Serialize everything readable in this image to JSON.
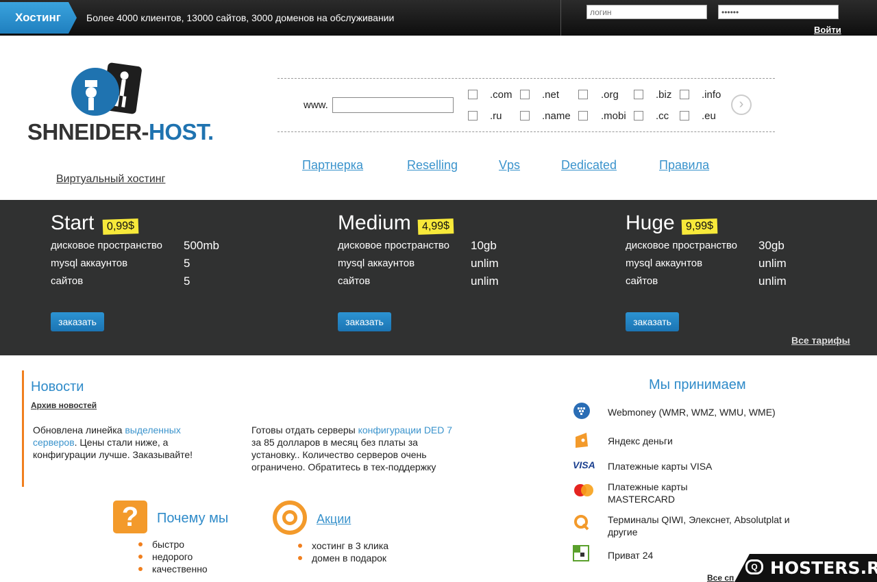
{
  "topbar": {
    "tab": "Хостинг",
    "tagline": "Более 4000 клиентов, 13000 сайтов, 3000 доменов на обслуживании",
    "login_placeholder": "логин",
    "password_value": "••••••",
    "login_button": "Войти"
  },
  "logo": {
    "text_dark": "SHNEIDER-",
    "text_blue": "HOST."
  },
  "virtual_hosting": "Виртуальный хостинг",
  "domain": {
    "prefix": "www.",
    "zones_row1": [
      ".com",
      ".net",
      ".org",
      ".biz",
      ".info"
    ],
    "zones_row2": [
      ".ru",
      ".name",
      ".mobi",
      ".cc",
      ".eu"
    ]
  },
  "nav": [
    "Партнерка",
    "Reselling",
    "Vps",
    "Dedicated",
    "Правила"
  ],
  "plans": [
    {
      "name": "Start",
      "price": "0,99$",
      "disk": "500mb",
      "mysql": "5",
      "sites": "5"
    },
    {
      "name": "Medium",
      "price": "4,99$",
      "disk": "10gb",
      "mysql": "unlim",
      "sites": "unlim"
    },
    {
      "name": "Huge",
      "price": "9,99$",
      "disk": "30gb",
      "mysql": "unlim",
      "sites": "unlim"
    }
  ],
  "plan_labels": {
    "disk": "дисковое пространство",
    "mysql": "mysql аккаунтов",
    "sites": "сайтов"
  },
  "order_button": "заказать",
  "all_plans": "Все тарифы",
  "news": {
    "title": "Новости",
    "archive": "Архив новостей",
    "item1_before": "Обновлена линейка ",
    "item1_link": "выделенных серверов",
    "item1_after": ". Цены стали ниже, а конфигурации лучше. Заказывайте!",
    "item2_before": "Готовы отдать серверы ",
    "item2_link": "конфигурации DED 7",
    "item2_after": " за 85 долларов в месяц без платы за установку.. Количество серверов очень ограничено. Обратитесь в тех-поддержку"
  },
  "why": {
    "icon": "?",
    "title": "Почему мы",
    "items": [
      "быстро",
      "недорого",
      "качественно"
    ]
  },
  "promo": {
    "title": "Акции",
    "items": [
      "хостинг в 3 клика",
      "домен в подарок"
    ]
  },
  "payments": {
    "title": "Мы принимаем",
    "items": [
      {
        "icon": "webmoney-icon",
        "text": "Webmoney (WMR, WMZ, WMU, WME)"
      },
      {
        "icon": "yandex-money-icon",
        "text": "Яндекс деньги"
      },
      {
        "icon": "visa-icon",
        "text": "Платежные карты VISA"
      },
      {
        "icon": "mastercard-icon",
        "text": "Платежные карты MASTERCARD"
      },
      {
        "icon": "qiwi-icon",
        "text": "Терминалы QIWI, Элекснет, Absolutplat и другие"
      },
      {
        "icon": "privat24-icon",
        "text": "Приват 24"
      }
    ],
    "visa_label": "VISA",
    "all": "Все сп"
  },
  "watermark": "HOSTERS.RU"
}
